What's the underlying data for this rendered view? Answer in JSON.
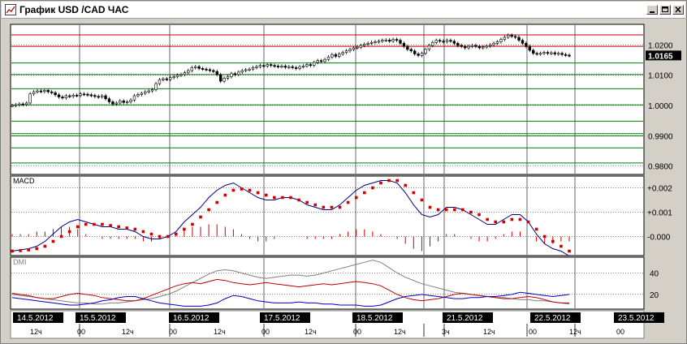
{
  "window": {
    "title": "График USD /CAD  ЧАС",
    "controls": {
      "minimize": "minimize-icon",
      "maximize": "maximize-icon",
      "close": "close-icon"
    }
  },
  "colors": {
    "background": "#ffffff",
    "frame": "#d4d0c8",
    "candle": "#000000",
    "red_level": "#c00000",
    "green_level": "#008000",
    "macd_line": "#000080",
    "signal": "#d00000",
    "histogram": "#d00000",
    "adx": "#808080",
    "plus_di": "#c00000",
    "minus_di": "#0000c0",
    "date_box": "#000000"
  },
  "chart_data": [
    {
      "type": "candlestick",
      "panel": "price",
      "y_ticks": [
        "1.0200",
        "1.0100",
        "1.0000",
        "0.9900",
        "0.9800"
      ],
      "y_tick_values": [
        1.02,
        1.01,
        1.0,
        0.99,
        0.98
      ],
      "ylim": [
        0.9775,
        1.0265
      ],
      "current_price": "1.0165",
      "current_price_value": 1.0165,
      "horizontal_levels_red": [
        1.0233,
        1.0195
      ],
      "horizontal_levels_green": [
        1.014,
        1.0102,
        1.0055,
        1.0002,
        0.9948,
        0.9907,
        0.99,
        0.986,
        0.981
      ],
      "close_series": [
        1.0,
        1.0002,
        1.0005,
        1.0003,
        1.0008,
        1.0038,
        1.0045,
        1.0048,
        1.0046,
        1.005,
        1.0045,
        1.0042,
        1.0035,
        1.0028,
        1.0025,
        1.0032,
        1.003,
        1.0034,
        1.0033,
        1.0038,
        1.0037,
        1.0035,
        1.0033,
        1.003,
        1.0028,
        1.0032,
        1.0022,
        1.0012,
        1.0005,
        1.0008,
        1.0015,
        1.001,
        1.0012,
        1.0018,
        1.0032,
        1.0036,
        1.004,
        1.0045,
        1.0048,
        1.0052,
        1.0072,
        1.0085,
        1.0088,
        1.0086,
        1.0092,
        1.0095,
        1.01,
        1.0102,
        1.0108,
        1.0115,
        1.0125,
        1.0128,
        1.0122,
        1.012,
        1.0118,
        1.0115,
        1.0112,
        1.0102,
        1.008,
        1.009,
        1.0095,
        1.0105,
        1.0102,
        1.011,
        1.0115,
        1.0118,
        1.012,
        1.0125,
        1.0128,
        1.0132,
        1.013,
        1.0135,
        1.0132,
        1.013,
        1.0128,
        1.013,
        1.0126,
        1.0128,
        1.0125,
        1.0122,
        1.0128,
        1.013,
        1.0135,
        1.0132,
        1.0142,
        1.0148,
        1.0145,
        1.0152,
        1.016,
        1.0168,
        1.0162,
        1.017,
        1.0175,
        1.018,
        1.0185,
        1.019,
        1.0192,
        1.0198,
        1.0202,
        1.0205,
        1.0208,
        1.021,
        1.0212,
        1.0215,
        1.0216,
        1.0212,
        1.0218,
        1.0215,
        1.0205,
        1.0195,
        1.0185,
        1.018,
        1.017,
        1.0165,
        1.0172,
        1.0185,
        1.0198,
        1.0208,
        1.0215,
        1.0212,
        1.021,
        1.0215,
        1.0212,
        1.0205,
        1.0198,
        1.0195,
        1.019,
        1.0195,
        1.0198,
        1.0195,
        1.019,
        1.0193,
        1.0196,
        1.02,
        1.0205,
        1.021,
        1.0218,
        1.0225,
        1.0232,
        1.0228,
        1.0225,
        1.0215,
        1.0205,
        1.0195,
        1.0182,
        1.0172,
        1.017,
        1.0172,
        1.0175,
        1.0172,
        1.0174,
        1.017,
        1.0172,
        1.0168,
        1.0166,
        1.0165
      ]
    },
    {
      "type": "line",
      "panel": "macd",
      "label": "MACD",
      "y_ticks": [
        "+0.002",
        "+0.001",
        "-0.000"
      ],
      "y_tick_values": [
        0.002,
        0.001,
        0.0
      ],
      "ylim": [
        -0.00075,
        0.00245
      ],
      "series": [
        {
          "key": "macd",
          "style": "line",
          "values": [
            -0.0006,
            -0.00055,
            -0.0005,
            -0.0004,
            -0.0002,
            0.0001,
            0.0004,
            0.0006,
            0.0007,
            0.0006,
            0.0005,
            0.0004,
            0.0004,
            0.0003,
            0.0003,
            0.0002,
            0.0,
            -0.0001,
            -0.0001,
            0.0,
            0.0002,
            0.0006,
            0.0009,
            0.0012,
            0.0016,
            0.0019,
            0.0021,
            0.0022,
            0.002,
            0.0018,
            0.0016,
            0.0015,
            0.0015,
            0.0016,
            0.0016,
            0.0015,
            0.0013,
            0.0012,
            0.0011,
            0.0011,
            0.0013,
            0.0016,
            0.0019,
            0.0021,
            0.0022,
            0.0023,
            0.0023,
            0.0022,
            0.0018,
            0.0013,
            0.0009,
            0.0008,
            0.0009,
            0.0012,
            0.0012,
            0.0011,
            0.0009,
            0.0007,
            0.0005,
            0.0005,
            0.0007,
            0.0009,
            0.0009,
            0.0006,
            0.0001,
            -0.0003,
            -0.0005,
            -0.0006,
            -0.0008
          ]
        },
        {
          "key": "signal",
          "style": "dots",
          "values": [
            -0.0006,
            -0.00058,
            -0.00055,
            -0.0005,
            -0.0004,
            -0.0002,
            0.0,
            0.0002,
            0.0004,
            0.0005,
            0.0005,
            0.0005,
            0.00045,
            0.0004,
            0.00035,
            0.0003,
            0.0002,
            0.0001,
            0.0,
            0.0,
            0.0001,
            0.0003,
            0.0005,
            0.0008,
            0.0011,
            0.0014,
            0.0017,
            0.0019,
            0.00195,
            0.0019,
            0.0018,
            0.0017,
            0.0016,
            0.0016,
            0.0016,
            0.0015,
            0.0014,
            0.0013,
            0.0012,
            0.0012,
            0.0012,
            0.0014,
            0.0016,
            0.0018,
            0.002,
            0.0022,
            0.0023,
            0.0023,
            0.0021,
            0.0018,
            0.0015,
            0.0012,
            0.0011,
            0.0011,
            0.0011,
            0.0011,
            0.001,
            0.0009,
            0.0007,
            0.0006,
            0.0006,
            0.0007,
            0.0007,
            0.0006,
            0.0003,
            0.0,
            -0.0002,
            -0.0004,
            -0.0006
          ]
        },
        {
          "key": "histogram",
          "style": "bars",
          "values": [
            0.0001,
            0.0001,
            0.0001,
            0.0002,
            0.0002,
            0.0003,
            0.0004,
            0.0004,
            0.0003,
            0.0001,
            0.0,
            -0.0001,
            -0.0001,
            -0.0001,
            -0.0001,
            -0.0001,
            -0.0002,
            -0.0002,
            -0.0001,
            0.0,
            0.0001,
            0.0003,
            0.0004,
            0.0004,
            0.0005,
            0.0005,
            0.0004,
            0.0003,
            0.0001,
            -0.0001,
            -0.0002,
            -0.0002,
            -0.0001,
            0.0,
            0.0,
            0.0,
            -0.0001,
            -0.0001,
            -0.0001,
            -0.0001,
            0.0001,
            0.0002,
            0.0003,
            0.0003,
            0.0002,
            0.0001,
            0.0,
            -0.0001,
            -0.0003,
            -0.0005,
            -0.0006,
            -0.0004,
            -0.0002,
            0.0001,
            0.0001,
            0.0,
            -0.0001,
            -0.0002,
            -0.0002,
            -0.0001,
            0.0001,
            0.0002,
            0.0002,
            0.0,
            -0.0002,
            -0.0003,
            -0.0003,
            -0.0002,
            -0.0002
          ]
        }
      ]
    },
    {
      "type": "line",
      "panel": "dmi",
      "label": "DMI",
      "y_ticks": [
        "40",
        "20"
      ],
      "y_tick_values": [
        40,
        20
      ],
      "ylim": [
        7,
        54
      ],
      "series": [
        {
          "key": "adx",
          "values": [
            20,
            19,
            18,
            17,
            16,
            15,
            14,
            13,
            12,
            12,
            11,
            11,
            12,
            12,
            13,
            14,
            15,
            16,
            18,
            20,
            23,
            27,
            31,
            35,
            39,
            42,
            43,
            42,
            40,
            38,
            36,
            35,
            36,
            37,
            38,
            38,
            37,
            38,
            40,
            42,
            44,
            46,
            48,
            50,
            52,
            50,
            45,
            40,
            36,
            33,
            30,
            28,
            26,
            24,
            22,
            21,
            20,
            19,
            18,
            17,
            17,
            16,
            15,
            15,
            14,
            14,
            13,
            12,
            11
          ]
        },
        {
          "key": "plus_di",
          "values": [
            21,
            20,
            19,
            17,
            16,
            16,
            18,
            20,
            21,
            20,
            19,
            17,
            16,
            15,
            14,
            14,
            16,
            19,
            22,
            25,
            28,
            30,
            31,
            30,
            32,
            34,
            33,
            31,
            30,
            29,
            30,
            31,
            30,
            29,
            28,
            27,
            28,
            29,
            30,
            29,
            30,
            31,
            32,
            31,
            30,
            28,
            24,
            20,
            17,
            15,
            14,
            15,
            16,
            18,
            20,
            21,
            20,
            19,
            18,
            17,
            16,
            16,
            17,
            18,
            17,
            15,
            13,
            12,
            12
          ]
        },
        {
          "key": "minus_di",
          "values": [
            17,
            16,
            15,
            14,
            13,
            12,
            11,
            10,
            10,
            11,
            12,
            14,
            15,
            17,
            18,
            18,
            16,
            14,
            12,
            11,
            10,
            9,
            9,
            9,
            10,
            12,
            16,
            19,
            18,
            16,
            14,
            13,
            12,
            12,
            12,
            13,
            12,
            12,
            11,
            11,
            10,
            10,
            10,
            9,
            9,
            10,
            13,
            16,
            18,
            19,
            20,
            19,
            18,
            17,
            16,
            16,
            17,
            17,
            18,
            18,
            19,
            20,
            22,
            21,
            20,
            19,
            18,
            19,
            20
          ]
        }
      ]
    }
  ],
  "time_axis": {
    "dates": [
      {
        "label": "14.5.2012"
      },
      {
        "label": "15.5.2012"
      },
      {
        "label": "16.5.2012"
      },
      {
        "label": "17.5.2012"
      },
      {
        "label": "18.5.2012"
      },
      {
        "label": "21.5.2012"
      },
      {
        "label": "22.5.2012"
      },
      {
        "label": "23.5.2012"
      }
    ],
    "hours": [
      {
        "label": "12ч"
      },
      {
        "label": "00"
      },
      {
        "label": "12ч"
      },
      {
        "label": "00"
      },
      {
        "label": "12ч"
      },
      {
        "label": "00"
      },
      {
        "label": "12ч"
      },
      {
        "label": "00"
      },
      {
        "label": "12ч"
      },
      {
        "label": "3ч"
      },
      {
        "label": "12ч"
      },
      {
        "label": "00"
      },
      {
        "label": "12ч"
      },
      {
        "label": "00"
      }
    ]
  }
}
